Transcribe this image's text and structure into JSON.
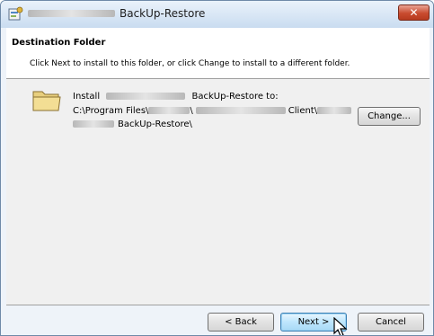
{
  "window": {
    "title": "BackUp-Restore",
    "close_label": "✕"
  },
  "header": {
    "title": "Destination Folder",
    "description": "Click Next to install to this folder, or click Change to install to a different folder."
  },
  "install": {
    "install_word": "Install",
    "install_tail": "BackUp-Restore to:",
    "path_prefix": "C:\\Program Files\\",
    "path_sep": "\\",
    "path_client": "Client\\",
    "path_end": "BackUp-Restore\\"
  },
  "buttons": {
    "change": "Change...",
    "back": "< Back",
    "next": "Next >",
    "cancel": "Cancel"
  }
}
